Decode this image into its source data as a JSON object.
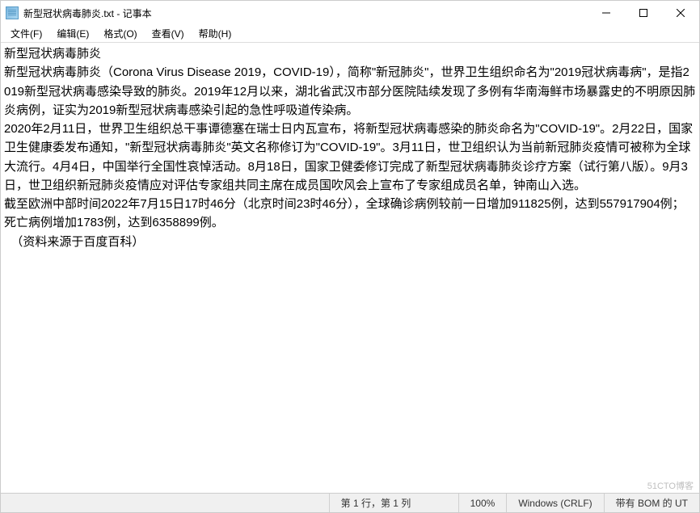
{
  "titlebar": {
    "title": "新型冠状病毒肺炎.txt - 记事本"
  },
  "menubar": {
    "file": "文件(F)",
    "edit": "编辑(E)",
    "format": "格式(O)",
    "view": "查看(V)",
    "help": "帮助(H)"
  },
  "content": {
    "text": "新型冠状病毒肺炎\n新型冠状病毒肺炎（Corona Virus Disease 2019，COVID-19），简称\"新冠肺炎\"，世界卫生组织命名为\"2019冠状病毒病\"，是指2019新型冠状病毒感染导致的肺炎。2019年12月以来，湖北省武汉市部分医院陆续发现了多例有华南海鲜市场暴露史的不明原因肺炎病例，证实为2019新型冠状病毒感染引起的急性呼吸道传染病。\n2020年2月11日，世界卫生组织总干事谭德塞在瑞士日内瓦宣布，将新型冠状病毒感染的肺炎命名为\"COVID-19\"。2月22日，国家卫生健康委发布通知，\"新型冠状病毒肺炎\"英文名称修订为\"COVID-19\"。3月11日，世卫组织认为当前新冠肺炎疫情可被称为全球大流行。4月4日，中国举行全国性哀悼活动。8月18日，国家卫健委修订完成了新型冠状病毒肺炎诊疗方案（试行第八版）。9月3日，世卫组织新冠肺炎疫情应对评估专家组共同主席在成员国吹风会上宣布了专家组成员名单，钟南山入选。\n截至欧洲中部时间2022年7月15日17时46分（北京时间23时46分），全球确诊病例较前一日增加911825例，达到557917904例；死亡病例增加1783例，达到6358899例。\n  （资料来源于百度百科）"
  },
  "statusbar": {
    "position": "第 1 行，第 1 列",
    "zoom": "100%",
    "line_ending": "Windows (CRLF)",
    "encoding": "带有 BOM 的 UT"
  },
  "watermark": "51CTO博客"
}
